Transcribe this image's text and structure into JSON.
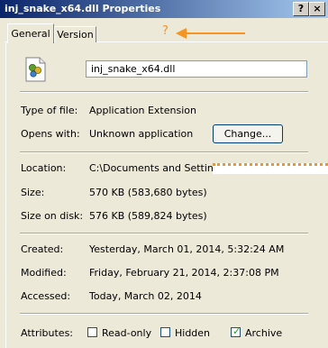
{
  "window": {
    "title": "inj_snake_x64.dll Properties",
    "help_button": "?",
    "close_button": "×"
  },
  "tabs": [
    {
      "label": "General",
      "selected": true
    },
    {
      "label": "Version",
      "selected": false
    }
  ],
  "annotation": {
    "mark": "?",
    "color": "#f7931e"
  },
  "file": {
    "icon": "dll-file-icon",
    "name": "inj_snake_x64.dll"
  },
  "details": {
    "type_label": "Type of file:",
    "type_value": "Application Extension",
    "opens_label": "Opens with:",
    "opens_value": "Unknown application",
    "change_button": "Change...",
    "location_label": "Location:",
    "location_value": "C:\\Documents and Settings\\",
    "size_label": "Size:",
    "size_value": "570 KB (583,680 bytes)",
    "size_on_disk_label": "Size on disk:",
    "size_on_disk_value": "576 KB (589,824 bytes)",
    "created_label": "Created:",
    "created_value": "Yesterday, March 01, 2014, 5:32:24 AM",
    "modified_label": "Modified:",
    "modified_value": "Friday, February 21, 2014, 2:37:08 PM",
    "accessed_label": "Accessed:",
    "accessed_value": "Today, March 02, 2014"
  },
  "attributes": {
    "label": "Attributes:",
    "read_only": {
      "label": "Read-only",
      "checked": false
    },
    "hidden": {
      "label": "Hidden",
      "checked": false
    },
    "archive": {
      "label": "Archive",
      "checked": true
    }
  },
  "colors": {
    "title_bar": "#0a246a",
    "dialog_bg": "#ece9d8",
    "annotation": "#f7931e",
    "check": "#21a121"
  }
}
